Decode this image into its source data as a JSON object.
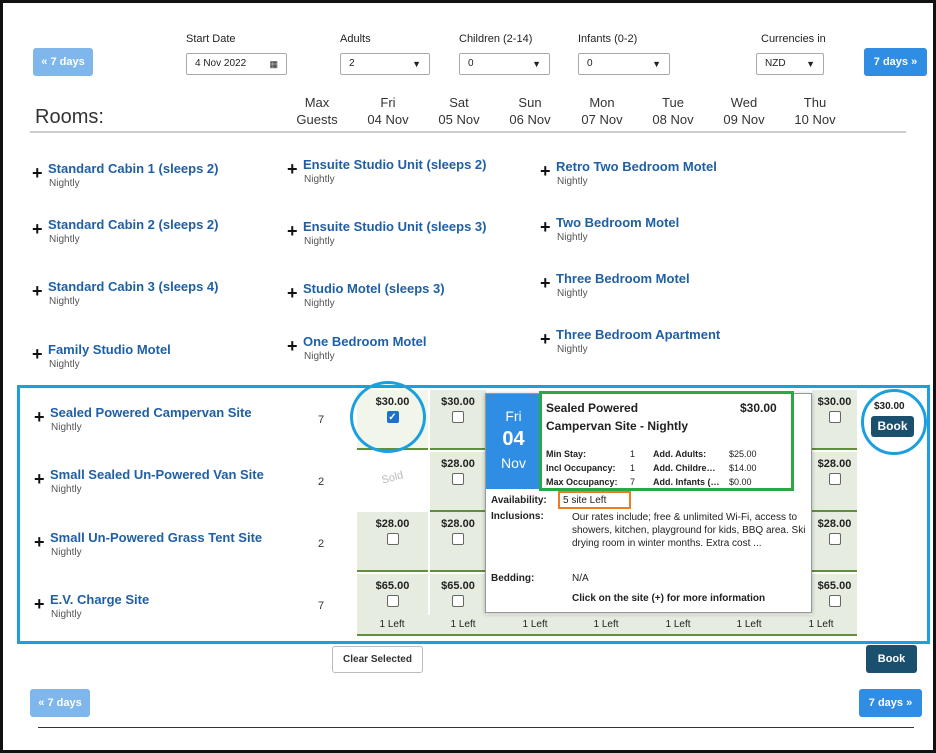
{
  "nav": {
    "prev_label": "« 7 days",
    "next_label": "7 days »"
  },
  "filters": {
    "start_date": {
      "label": "Start Date",
      "value": "4 Nov 2022"
    },
    "adults": {
      "label": "Adults",
      "value": "2"
    },
    "children": {
      "label": "Children (2-14)",
      "value": "0"
    },
    "infants": {
      "label": "Infants (0-2)",
      "value": "0"
    },
    "currency": {
      "label": "Currencies in",
      "value": "NZD"
    }
  },
  "header": {
    "rooms_label": "Rooms:",
    "max_guests_1": "Max",
    "max_guests_2": "Guests",
    "days": [
      {
        "dow": "Fri",
        "date": "04 Nov"
      },
      {
        "dow": "Sat",
        "date": "05 Nov"
      },
      {
        "dow": "Sun",
        "date": "06 Nov"
      },
      {
        "dow": "Mon",
        "date": "07 Nov"
      },
      {
        "dow": "Tue",
        "date": "08 Nov"
      },
      {
        "dow": "Wed",
        "date": "09 Nov"
      },
      {
        "dow": "Thu",
        "date": "10 Nov"
      }
    ]
  },
  "rooms": {
    "col1": [
      {
        "name": "Standard Cabin 1 (sleeps 2)",
        "sub": "Nightly"
      },
      {
        "name": "Standard Cabin 2 (sleeps 2)",
        "sub": "Nightly"
      },
      {
        "name": "Standard Cabin 3 (sleeps 4)",
        "sub": "Nightly"
      },
      {
        "name": "Family Studio Motel",
        "sub": "Nightly"
      }
    ],
    "col2": [
      {
        "name": "Ensuite Studio Unit (sleeps 2)",
        "sub": "Nightly"
      },
      {
        "name": "Ensuite Studio Unit (sleeps 3)",
        "sub": "Nightly"
      },
      {
        "name": "Studio Motel (sleeps 3)",
        "sub": "Nightly"
      },
      {
        "name": "One Bedroom Motel",
        "sub": "Nightly"
      }
    ],
    "col3": [
      {
        "name": "Retro Two Bedroom Motel",
        "sub": "Nightly"
      },
      {
        "name": "Two Bedroom Motel",
        "sub": "Nightly"
      },
      {
        "name": "Three Bedroom Motel",
        "sub": "Nightly"
      },
      {
        "name": "Three Bedroom Apartment",
        "sub": "Nightly"
      }
    ]
  },
  "sites": [
    {
      "name": "Sealed Powered Campervan Site",
      "sub": "Nightly",
      "guests": "7",
      "p1": "$30.00",
      "p2": "$30.00",
      "p7": "$30.00"
    },
    {
      "name": "Small Sealed Un-Powered Van Site",
      "sub": "Nightly",
      "guests": "2",
      "sold": "Sold",
      "p2": "$28.00",
      "p7": "$28.00"
    },
    {
      "name": "Small Un-Powered Grass Tent Site",
      "sub": "Nightly",
      "guests": "2",
      "p1": "$28.00",
      "p2": "$28.00",
      "p7": "$28.00"
    },
    {
      "name": "E.V. Charge Site",
      "sub": "Nightly",
      "guests": "7",
      "p1": "$65.00",
      "p2": "$65.00",
      "p7": "$65.00"
    }
  ],
  "left_labels": [
    "1 Left",
    "1 Left",
    "1 Left",
    "1 Left",
    "1 Left",
    "1 Left",
    "1 Left"
  ],
  "total": {
    "price": "$30.00",
    "book_label": "Book"
  },
  "clear_label": "Clear Selected",
  "popup": {
    "dow": "Fri",
    "day": "04",
    "month": "Nov",
    "title1": "Sealed Powered",
    "title2": "Campervan Site - Nightly",
    "price": "$30.00",
    "min_stay_l": "Min Stay:",
    "min_stay_v": "1",
    "add_adults": "Add. Adults:",
    "add_adults_v": "$25.00",
    "incl_occ_l": "Incl Occupancy:",
    "incl_occ_v": "1",
    "add_children": "Add. Childre…",
    "add_children_v": "$14.00",
    "max_occ_l": "Max Occupancy:",
    "max_occ_v": "7",
    "add_infants": "Add. Infants (…",
    "add_infants_v": "$0.00",
    "avail_l": "Availability:",
    "avail_v": "5 site Left",
    "incl_l": "Inclusions:",
    "incl_v": "Our rates include; free & unlimited Wi-Fi, access to showers, kitchen, playground for kids, BBQ area. Ski drying room in winter months. Extra cost ...",
    "bedding_l": "Bedding:",
    "bedding_v": "N/A",
    "footer": "Click on the site (+) for more information"
  },
  "colors": {
    "accent": "#2f8de4",
    "highlight_blue": "#1aa0de",
    "highlight_green": "#2aa843",
    "highlight_orange": "#f07c1f",
    "dark_button": "#1b4f6e"
  }
}
